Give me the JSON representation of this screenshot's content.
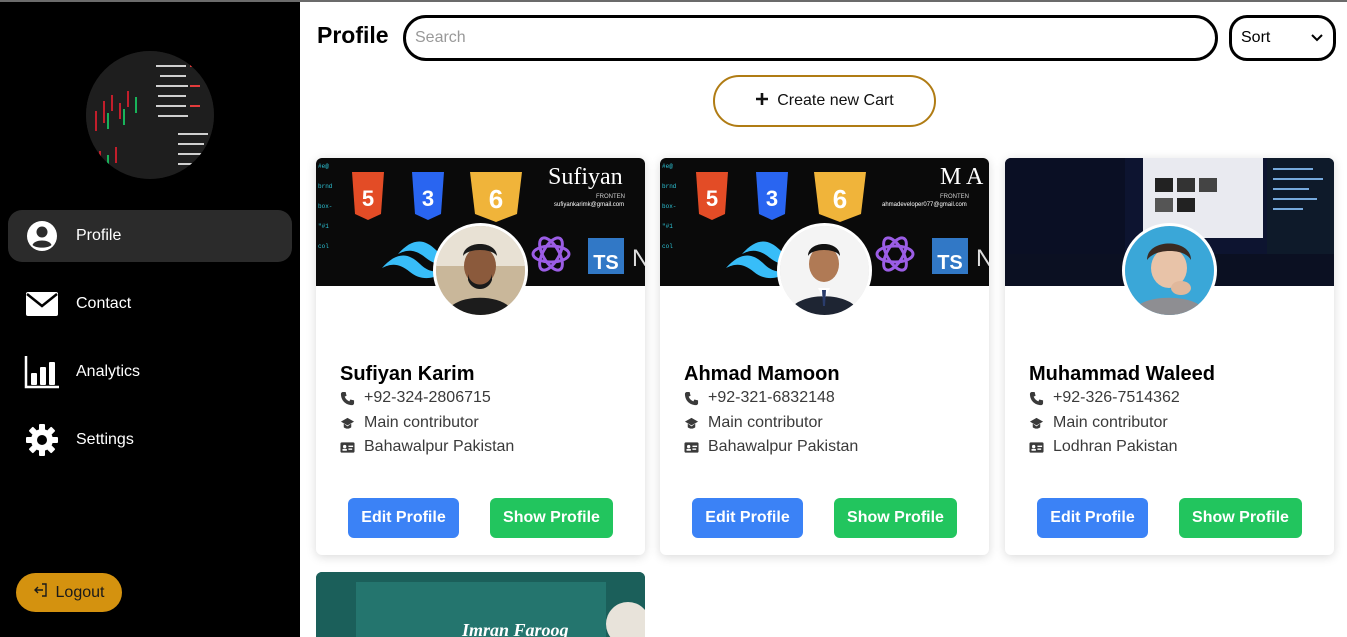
{
  "sidebar": {
    "items": [
      {
        "label": "Profile",
        "icon": "user-circle-icon",
        "active": true
      },
      {
        "label": "Contact",
        "icon": "envelope-icon",
        "active": false
      },
      {
        "label": "Analytics",
        "icon": "bar-chart-icon",
        "active": false
      },
      {
        "label": "Settings",
        "icon": "gear-icon",
        "active": false
      }
    ],
    "logout_label": "Logout"
  },
  "header": {
    "title": "Profile",
    "search_placeholder": "Search",
    "sort_label": "Sort"
  },
  "create_label": "Create new Cart",
  "cards": [
    {
      "name": "Sufiyan Karim",
      "phone": "+92-324-2806715",
      "role": "Main contributor",
      "location": "Bahawalpur Pakistan",
      "banner_title": "Sufiyan",
      "banner_sub": "FRONTEN",
      "banner_email": "sufiyankarimk@gmail.com",
      "edit_label": "Edit Profile",
      "show_label": "Show Profile"
    },
    {
      "name": "Ahmad Mamoon",
      "phone": "+92-321-6832148",
      "role": "Main contributor",
      "location": "Bahawalpur Pakistan",
      "banner_title": "M A",
      "banner_sub": "FRONTEN",
      "banner_email": "ahmadeveloper077@gmail.com",
      "edit_label": "Edit Profile",
      "show_label": "Show Profile"
    },
    {
      "name": "Muhammad Waleed",
      "phone": "+92-326-7514362",
      "role": "Main contributor",
      "location": "Lodhran Pakistan",
      "edit_label": "Edit Profile",
      "show_label": "Show Profile"
    }
  ],
  "card4": {
    "banner_title": "Imran Farooq"
  },
  "colors": {
    "accent": "#d4920f",
    "edit": "#3b82f6",
    "show": "#22c55e",
    "sidebar": "#000000"
  }
}
